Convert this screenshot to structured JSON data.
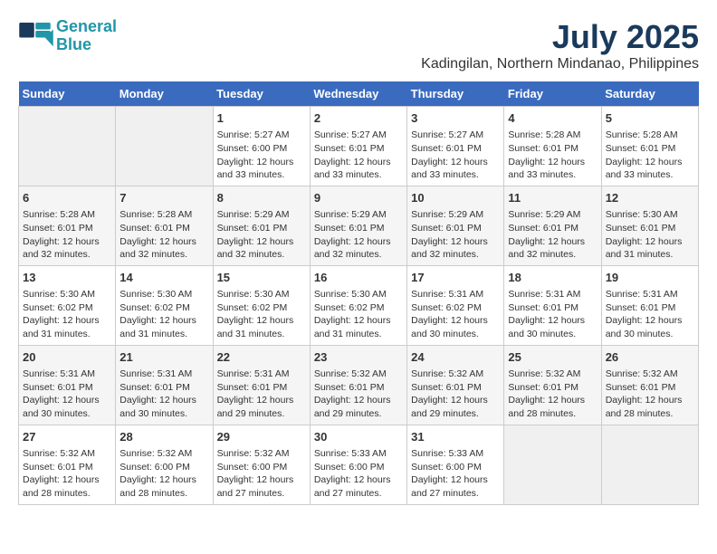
{
  "logo": {
    "line1": "General",
    "line2": "Blue"
  },
  "title": "July 2025",
  "subtitle": "Kadingilan, Northern Mindanao, Philippines",
  "days_of_week": [
    "Sunday",
    "Monday",
    "Tuesday",
    "Wednesday",
    "Thursday",
    "Friday",
    "Saturday"
  ],
  "weeks": [
    [
      {
        "day": "",
        "content": ""
      },
      {
        "day": "",
        "content": ""
      },
      {
        "day": "1",
        "content": "Sunrise: 5:27 AM\nSunset: 6:00 PM\nDaylight: 12 hours and 33 minutes."
      },
      {
        "day": "2",
        "content": "Sunrise: 5:27 AM\nSunset: 6:01 PM\nDaylight: 12 hours and 33 minutes."
      },
      {
        "day": "3",
        "content": "Sunrise: 5:27 AM\nSunset: 6:01 PM\nDaylight: 12 hours and 33 minutes."
      },
      {
        "day": "4",
        "content": "Sunrise: 5:28 AM\nSunset: 6:01 PM\nDaylight: 12 hours and 33 minutes."
      },
      {
        "day": "5",
        "content": "Sunrise: 5:28 AM\nSunset: 6:01 PM\nDaylight: 12 hours and 33 minutes."
      }
    ],
    [
      {
        "day": "6",
        "content": "Sunrise: 5:28 AM\nSunset: 6:01 PM\nDaylight: 12 hours and 32 minutes."
      },
      {
        "day": "7",
        "content": "Sunrise: 5:28 AM\nSunset: 6:01 PM\nDaylight: 12 hours and 32 minutes."
      },
      {
        "day": "8",
        "content": "Sunrise: 5:29 AM\nSunset: 6:01 PM\nDaylight: 12 hours and 32 minutes."
      },
      {
        "day": "9",
        "content": "Sunrise: 5:29 AM\nSunset: 6:01 PM\nDaylight: 12 hours and 32 minutes."
      },
      {
        "day": "10",
        "content": "Sunrise: 5:29 AM\nSunset: 6:01 PM\nDaylight: 12 hours and 32 minutes."
      },
      {
        "day": "11",
        "content": "Sunrise: 5:29 AM\nSunset: 6:01 PM\nDaylight: 12 hours and 32 minutes."
      },
      {
        "day": "12",
        "content": "Sunrise: 5:30 AM\nSunset: 6:01 PM\nDaylight: 12 hours and 31 minutes."
      }
    ],
    [
      {
        "day": "13",
        "content": "Sunrise: 5:30 AM\nSunset: 6:02 PM\nDaylight: 12 hours and 31 minutes."
      },
      {
        "day": "14",
        "content": "Sunrise: 5:30 AM\nSunset: 6:02 PM\nDaylight: 12 hours and 31 minutes."
      },
      {
        "day": "15",
        "content": "Sunrise: 5:30 AM\nSunset: 6:02 PM\nDaylight: 12 hours and 31 minutes."
      },
      {
        "day": "16",
        "content": "Sunrise: 5:30 AM\nSunset: 6:02 PM\nDaylight: 12 hours and 31 minutes."
      },
      {
        "day": "17",
        "content": "Sunrise: 5:31 AM\nSunset: 6:02 PM\nDaylight: 12 hours and 30 minutes."
      },
      {
        "day": "18",
        "content": "Sunrise: 5:31 AM\nSunset: 6:01 PM\nDaylight: 12 hours and 30 minutes."
      },
      {
        "day": "19",
        "content": "Sunrise: 5:31 AM\nSunset: 6:01 PM\nDaylight: 12 hours and 30 minutes."
      }
    ],
    [
      {
        "day": "20",
        "content": "Sunrise: 5:31 AM\nSunset: 6:01 PM\nDaylight: 12 hours and 30 minutes."
      },
      {
        "day": "21",
        "content": "Sunrise: 5:31 AM\nSunset: 6:01 PM\nDaylight: 12 hours and 30 minutes."
      },
      {
        "day": "22",
        "content": "Sunrise: 5:31 AM\nSunset: 6:01 PM\nDaylight: 12 hours and 29 minutes."
      },
      {
        "day": "23",
        "content": "Sunrise: 5:32 AM\nSunset: 6:01 PM\nDaylight: 12 hours and 29 minutes."
      },
      {
        "day": "24",
        "content": "Sunrise: 5:32 AM\nSunset: 6:01 PM\nDaylight: 12 hours and 29 minutes."
      },
      {
        "day": "25",
        "content": "Sunrise: 5:32 AM\nSunset: 6:01 PM\nDaylight: 12 hours and 28 minutes."
      },
      {
        "day": "26",
        "content": "Sunrise: 5:32 AM\nSunset: 6:01 PM\nDaylight: 12 hours and 28 minutes."
      }
    ],
    [
      {
        "day": "27",
        "content": "Sunrise: 5:32 AM\nSunset: 6:01 PM\nDaylight: 12 hours and 28 minutes."
      },
      {
        "day": "28",
        "content": "Sunrise: 5:32 AM\nSunset: 6:00 PM\nDaylight: 12 hours and 28 minutes."
      },
      {
        "day": "29",
        "content": "Sunrise: 5:32 AM\nSunset: 6:00 PM\nDaylight: 12 hours and 27 minutes."
      },
      {
        "day": "30",
        "content": "Sunrise: 5:33 AM\nSunset: 6:00 PM\nDaylight: 12 hours and 27 minutes."
      },
      {
        "day": "31",
        "content": "Sunrise: 5:33 AM\nSunset: 6:00 PM\nDaylight: 12 hours and 27 minutes."
      },
      {
        "day": "",
        "content": ""
      },
      {
        "day": "",
        "content": ""
      }
    ]
  ]
}
